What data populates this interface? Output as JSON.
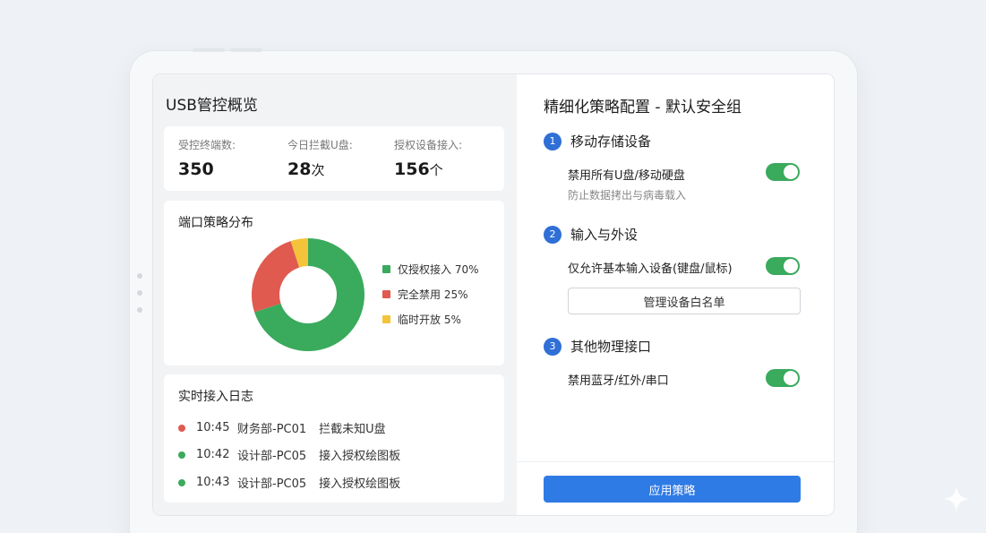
{
  "overview": {
    "title": "USB管控概览",
    "stats": [
      {
        "label": "受控终端数:",
        "value": "350",
        "unit": ""
      },
      {
        "label": "今日拦截U盘:",
        "value": "28",
        "unit": "次"
      },
      {
        "label": "授权设备接入:",
        "value": "156",
        "unit": "个"
      }
    ]
  },
  "chart_data": {
    "type": "pie",
    "title": "端口策略分布",
    "slices": [
      {
        "name": "仅授权接入",
        "value": 70,
        "label": "仅授权接入 70%",
        "color": "#3aaa5d"
      },
      {
        "name": "完全禁用",
        "value": 25,
        "label": "完全禁用 25%",
        "color": "#e05a4f"
      },
      {
        "name": "临时开放",
        "value": 5,
        "label": "临时开放 5%",
        "color": "#f3c43a"
      }
    ],
    "donut": true,
    "legend_position": "right"
  },
  "log": {
    "title": "实时接入日志",
    "items": [
      {
        "time": "10:45",
        "source": "财务部-PC01",
        "event": "拦截未知U盘",
        "status_color": "#e05a4f"
      },
      {
        "time": "10:42",
        "source": "设计部-PC05",
        "event": "接入授权绘图板",
        "status_color": "#3aaa5d"
      },
      {
        "time": "10:43",
        "source": "设计部-PC05",
        "event": "接入授权绘图板",
        "status_color": "#3aaa5d"
      }
    ]
  },
  "policy": {
    "title": "精细化策略配置 - 默认安全组",
    "sections": [
      {
        "number": "1",
        "title": "移动存储设备",
        "setting": "禁用所有U盘/移动硬盘",
        "description": "防止数据拷出与病毒载入",
        "enabled": true
      },
      {
        "number": "2",
        "title": "输入与外设",
        "setting": "仅允许基本输入设备(键盘/鼠标)",
        "button": "管理设备白名单",
        "enabled": true
      },
      {
        "number": "3",
        "title": "其他物理接口",
        "setting": "禁用蓝牙/红外/串口",
        "enabled": true
      }
    ],
    "apply_label": "应用策略"
  },
  "colors": {
    "accent": "#2f7be5",
    "toggle_on": "#3aaa5d",
    "danger": "#e05a4f",
    "warning": "#f3c43a"
  }
}
